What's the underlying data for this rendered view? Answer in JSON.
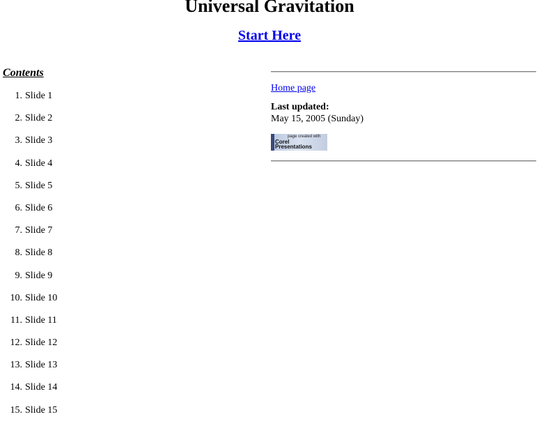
{
  "header": {
    "title": "Universal Gravitation",
    "start_link": "Start Here"
  },
  "contents": {
    "heading": "Contents",
    "items": [
      {
        "num": "1.",
        "label": "Slide 1"
      },
      {
        "num": "2.",
        "label": "Slide 2"
      },
      {
        "num": "3.",
        "label": "Slide 3"
      },
      {
        "num": "4.",
        "label": "Slide 4"
      },
      {
        "num": "5.",
        "label": "Slide 5"
      },
      {
        "num": "6.",
        "label": "Slide 6"
      },
      {
        "num": "7.",
        "label": "Slide 7"
      },
      {
        "num": "8.",
        "label": "Slide 8"
      },
      {
        "num": "9.",
        "label": "Slide 9"
      },
      {
        "num": "10.",
        "label": "Slide 10"
      },
      {
        "num": "11.",
        "label": "Slide 11"
      },
      {
        "num": "12.",
        "label": "Slide 12"
      },
      {
        "num": "13.",
        "label": "Slide 13"
      },
      {
        "num": "14.",
        "label": "Slide 14"
      },
      {
        "num": "15.",
        "label": "Slide 15"
      }
    ]
  },
  "info": {
    "home_link": "Home page",
    "updated_label": "Last updated:",
    "updated_value": "May 15, 2005 (Sunday)",
    "badge": {
      "line1": "page created with",
      "line2": "Corel",
      "line3": "Presentations"
    }
  },
  "colors": {
    "link": "#0000ee",
    "text": "#000000",
    "background": "#ffffff"
  }
}
